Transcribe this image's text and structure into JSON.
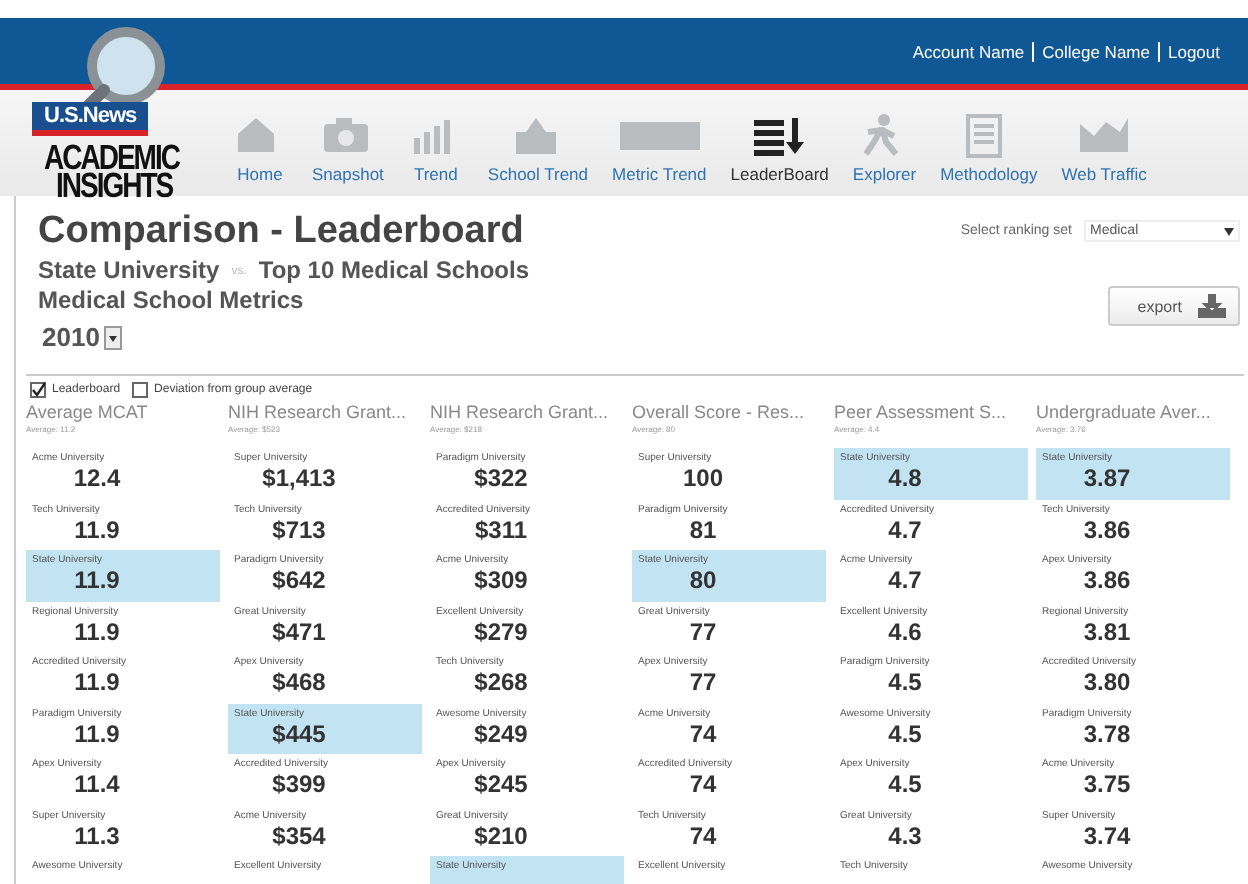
{
  "header": {
    "logo": {
      "brand": "U.S.News",
      "line_1": "ACADEMIC",
      "line_2": "INSIGHTS"
    },
    "account_links": [
      "Account Name",
      "College Name",
      "Logout"
    ]
  },
  "nav": [
    {
      "label": "Home",
      "selected": false
    },
    {
      "label": "Snapshot",
      "selected": false
    },
    {
      "label": "Trend",
      "selected": false
    },
    {
      "label": "School Trend",
      "selected": false
    },
    {
      "label": "Metric Trend",
      "selected": false
    },
    {
      "label": "LeaderBoard",
      "selected": true
    },
    {
      "label": "Explorer",
      "selected": false
    },
    {
      "label": "Methodology",
      "selected": false
    },
    {
      "label": "Web Traffic",
      "selected": false
    }
  ],
  "page": {
    "title": "Comparison - Leaderboard",
    "school": "State University",
    "vs": "vs.",
    "group": "Top 10 Medical Schools",
    "metric_set": "Medical School Metrics",
    "year": "2010",
    "ranking_label": "Select ranking set",
    "ranking_value": "Medical",
    "export_label": "export"
  },
  "options": [
    {
      "label": "Leaderboard",
      "checked": true
    },
    {
      "label": "Deviation from group average",
      "checked": false
    }
  ],
  "columns": [
    {
      "title": "Average MCAT",
      "average": "Average: 11.2",
      "rows": [
        {
          "name": "Acme University",
          "value": "12.4",
          "highlighted": false
        },
        {
          "name": "Tech University",
          "value": "11.9",
          "highlighted": false
        },
        {
          "name": "State University",
          "value": "11.9",
          "highlighted": true
        },
        {
          "name": "Regional University",
          "value": "11.9",
          "highlighted": false
        },
        {
          "name": "Accredited University",
          "value": "11.9",
          "highlighted": false
        },
        {
          "name": "Paradigm University",
          "value": "11.9",
          "highlighted": false
        },
        {
          "name": "Apex University",
          "value": "11.4",
          "highlighted": false
        },
        {
          "name": "Super University",
          "value": "11.3",
          "highlighted": false
        },
        {
          "name": "Awesome University",
          "highlighted": false
        }
      ]
    },
    {
      "title": "NIH Research Grant...",
      "average": "Average: $523",
      "rows": [
        {
          "name": "Super University",
          "value": "$1,413",
          "highlighted": false
        },
        {
          "name": "Tech University",
          "value": "$713",
          "highlighted": false
        },
        {
          "name": "Paradigm University",
          "value": "$642",
          "highlighted": false
        },
        {
          "name": "Great University",
          "value": "$471",
          "highlighted": false
        },
        {
          "name": "Apex University",
          "value": "$468",
          "highlighted": false
        },
        {
          "name": "State University",
          "value": "$445",
          "highlighted": true
        },
        {
          "name": "Accredited University",
          "value": "$399",
          "highlighted": false
        },
        {
          "name": "Acme University",
          "value": "$354",
          "highlighted": false
        },
        {
          "name": "Excellent University",
          "highlighted": false
        }
      ]
    },
    {
      "title": "NIH Research Grant...",
      "average": "Average: $218",
      "rows": [
        {
          "name": "Paradigm University",
          "value": "$322",
          "highlighted": false
        },
        {
          "name": "Accredited University",
          "value": "$311",
          "highlighted": false
        },
        {
          "name": "Acme University",
          "value": "$309",
          "highlighted": false
        },
        {
          "name": "Excellent University",
          "value": "$279",
          "highlighted": false
        },
        {
          "name": "Tech University",
          "value": "$268",
          "highlighted": false
        },
        {
          "name": "Awesome University",
          "value": "$249",
          "highlighted": false
        },
        {
          "name": "Apex University",
          "value": "$245",
          "highlighted": false
        },
        {
          "name": "Great University",
          "value": "$210",
          "highlighted": false
        },
        {
          "name": "State University",
          "highlighted": true
        }
      ]
    },
    {
      "title": "Overall Score - Res...",
      "average": "Average: 80",
      "rows": [
        {
          "name": "Super University",
          "value": "100",
          "highlighted": false
        },
        {
          "name": "Paradigm University",
          "value": "81",
          "highlighted": false
        },
        {
          "name": "State University",
          "value": "80",
          "highlighted": true
        },
        {
          "name": "Great University",
          "value": "77",
          "highlighted": false
        },
        {
          "name": "Apex University",
          "value": "77",
          "highlighted": false
        },
        {
          "name": "Acme University",
          "value": "74",
          "highlighted": false
        },
        {
          "name": "Accredited University",
          "value": "74",
          "highlighted": false
        },
        {
          "name": "Tech University",
          "value": "74",
          "highlighted": false
        },
        {
          "name": "Excellent University",
          "highlighted": false
        }
      ]
    },
    {
      "title": "Peer Assessment S...",
      "average": "Average: 4.4",
      "rows": [
        {
          "name": "State University",
          "value": "4.8",
          "highlighted": true
        },
        {
          "name": "Accredited University",
          "value": "4.7",
          "highlighted": false
        },
        {
          "name": "Acme University",
          "value": "4.7",
          "highlighted": false
        },
        {
          "name": "Excellent University",
          "value": "4.6",
          "highlighted": false
        },
        {
          "name": "Paradigm University",
          "value": "4.5",
          "highlighted": false
        },
        {
          "name": "Awesome University",
          "value": "4.5",
          "highlighted": false
        },
        {
          "name": "Apex University",
          "value": "4.5",
          "highlighted": false
        },
        {
          "name": "Great University",
          "value": "4.3",
          "highlighted": false
        },
        {
          "name": "Tech University",
          "highlighted": false
        }
      ]
    },
    {
      "title": "Undergraduate Aver...",
      "average": "Average: 3.76",
      "rows": [
        {
          "name": "State University",
          "value": "3.87",
          "highlighted": true
        },
        {
          "name": "Tech University",
          "value": "3.86",
          "highlighted": false
        },
        {
          "name": "Apex University",
          "value": "3.86",
          "highlighted": false
        },
        {
          "name": "Regional University",
          "value": "3.81",
          "highlighted": false
        },
        {
          "name": "Accredited University",
          "value": "3.80",
          "highlighted": false
        },
        {
          "name": "Paradigm University",
          "value": "3.78",
          "highlighted": false
        },
        {
          "name": "Acme University",
          "value": "3.75",
          "highlighted": false
        },
        {
          "name": "Super University",
          "value": "3.74",
          "highlighted": false
        },
        {
          "name": "Awesome University",
          "highlighted": false
        }
      ]
    }
  ]
}
